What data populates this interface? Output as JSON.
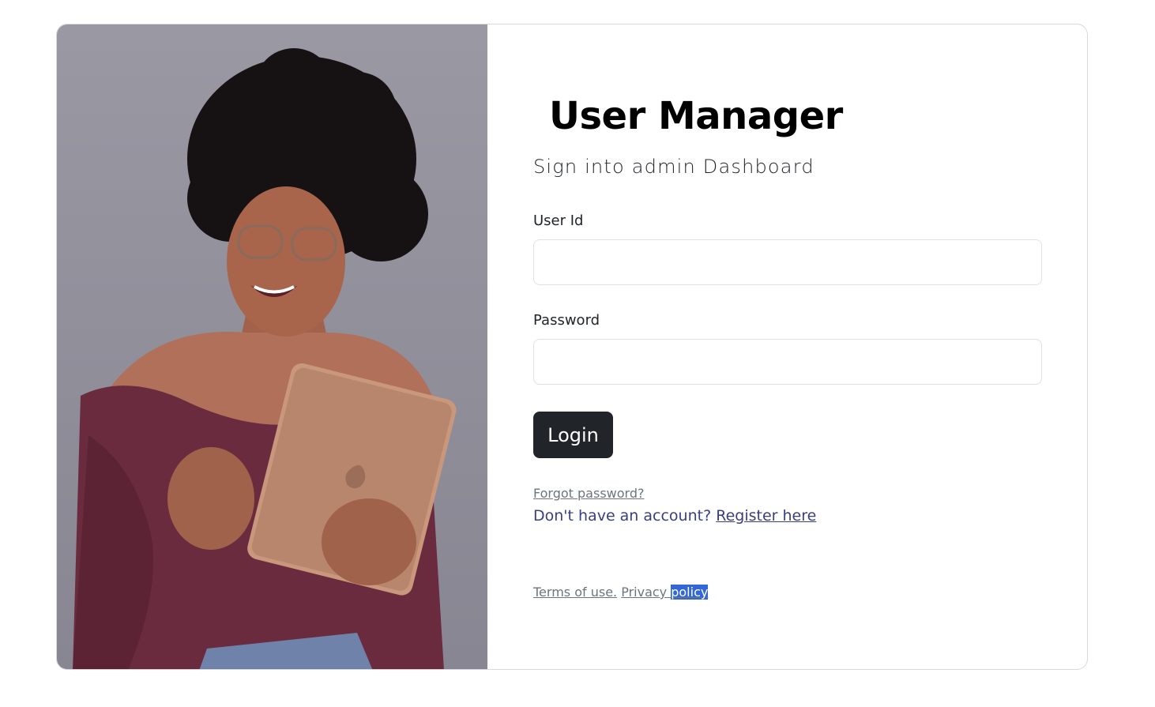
{
  "app": {
    "title": "User Manager",
    "subtitle": "Sign into admin Dashboard"
  },
  "form": {
    "user_id_label": "User Id",
    "user_id_value": "",
    "password_label": "Password",
    "password_value": "",
    "login_label": "Login"
  },
  "links": {
    "forgot_password": "Forgot password?",
    "no_account": "Don't have an account?",
    "register": "Register here",
    "terms": "Terms of use.",
    "privacy_part1": "Privacy ",
    "privacy_part2": "policy"
  },
  "colors": {
    "button_bg": "#212529",
    "register_link": "#393f81",
    "muted_link": "#6c757d",
    "selection": "#3367d6"
  },
  "image": {
    "icon": "woman-with-tablet-photo"
  }
}
